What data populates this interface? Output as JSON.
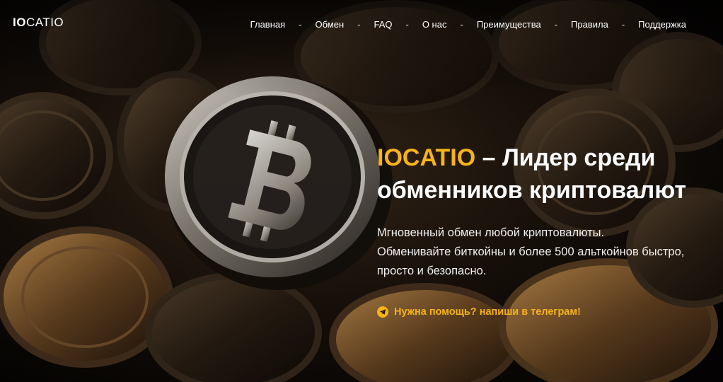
{
  "logo": {
    "part1": "IO",
    "part2": "CATIO"
  },
  "nav": [
    {
      "label": "Главная"
    },
    {
      "label": "Обмен"
    },
    {
      "label": "FAQ"
    },
    {
      "label": "О нас"
    },
    {
      "label": "Преимущества"
    },
    {
      "label": "Правила"
    },
    {
      "label": "Поддержка"
    }
  ],
  "nav_separator": "-",
  "hero": {
    "brand": "IOCATIO",
    "title_rest": " – Лидер среди",
    "title_line2": "обменников криптовалют",
    "subtitle_line1": "Мгновенный обмен любой криптовалюты.",
    "subtitle_line2": "Обменивайте биткойны и более 500 альткойнов быстро,",
    "subtitle_line3": "просто и безопасно."
  },
  "help": {
    "label": "Нужна помощь? напиши в телеграм!",
    "icon": "telegram-icon"
  },
  "colors": {
    "accent": "#f6b31b",
    "background": "#0a0705",
    "text": "#ffffff"
  }
}
